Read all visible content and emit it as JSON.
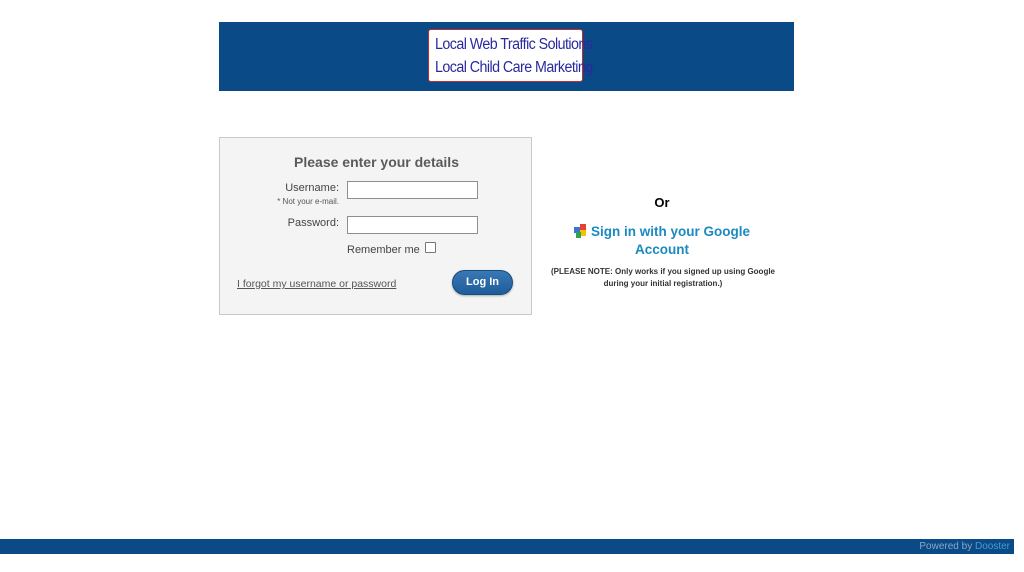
{
  "header": {
    "logo_line1": "Local Web Traffic Solutions",
    "logo_line2": "Local Child Care Marketing",
    "bg_color": "#0a4a86"
  },
  "login": {
    "title": "Please enter your details",
    "username_label": "Username:",
    "username_note": "* Not your e-mail.",
    "username_value": "",
    "password_label": "Password:",
    "password_value": "",
    "remember_label": "Remember me",
    "remember_checked": false,
    "forgot_link": "I forgot my username or password",
    "login_button": "Log In"
  },
  "alt": {
    "or_text": "Or",
    "google_signin": "Sign in with your Google Account",
    "google_icon": "google-icon",
    "note": "(PLEASE NOTE: Only works if you signed up using Google during your initial registration.)"
  },
  "footer": {
    "powered_by": "Powered by",
    "brand": "Dooster"
  }
}
